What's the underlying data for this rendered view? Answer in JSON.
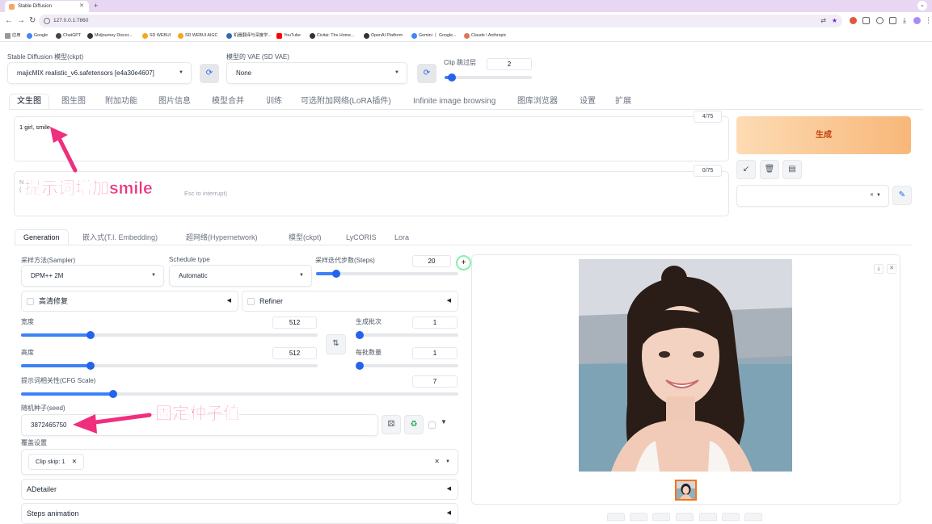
{
  "browser": {
    "tab_title": "Stable Diffusion",
    "url": "127.0.0.1:7860",
    "bookmarks": [
      "应用",
      "Google",
      "ChatGPT",
      "Midjourney Discor...",
      "SD WEBUI",
      "SD WEBUI AIGC",
      "机器翻译与深度学...",
      "YouTube",
      "Civitai: The Home...",
      "OpenAI Platform",
      "Gemini 丨 Google...",
      "Claude \\ Anthropic"
    ]
  },
  "top": {
    "model_label": "Stable Diffusion 模型(ckpt)",
    "model_value": "majicMIX realistic_v6.safetensors [e4a30e4607]",
    "vae_label": "模型的 VAE (SD VAE)",
    "vae_value": "None",
    "clip_label": "Clip 跳过层",
    "clip_value": "2",
    "clip_fraction": 0.083
  },
  "main_tabs": [
    "文生图",
    "图生图",
    "附加功能",
    "图片信息",
    "模型合并",
    "训练",
    "可选附加网络(LoRA插件)",
    "Infinite image browsing",
    "图库浏览器",
    "设置",
    "扩展"
  ],
  "prompt": {
    "text": "1 girl, smile",
    "counter": "4/75",
    "neg_placeholder_1": "N",
    "neg_placeholder_2": "(",
    "neg_placeholder_3": "Esc to interrupt)",
    "neg_counter": "0/75"
  },
  "generate_label": "生成",
  "sub_tabs": [
    "Generation",
    "嵌入式(T.I. Embedding)",
    "超网络(Hypernetwork)",
    "模型(ckpt)",
    "LyCORIS",
    "Lora"
  ],
  "gen": {
    "sampler_label": "采样方法(Sampler)",
    "sampler_value": "DPM++ 2M",
    "schedule_label": "Schedule type",
    "schedule_value": "Automatic",
    "steps_label": "采样迭代步数(Steps)",
    "steps_value": "20",
    "steps_fraction": 0.14,
    "hires_label": "高清修复",
    "refiner_label": "Refiner",
    "width_label": "宽度",
    "width_value": "512",
    "height_label": "高度",
    "height_value": "512",
    "batch_count_label": "生成批次",
    "batch_count_value": "1",
    "batch_size_label": "每批数量",
    "batch_size_value": "1",
    "cfg_label": "提示词相关性(CFG Scale)",
    "cfg_value": "7",
    "cfg_fraction": 0.21,
    "seed_label": "随机种子(seed)",
    "seed_value": "3872465750",
    "override_label": "覆盖设置",
    "override_chip": "Clip skip: 1",
    "adetailer_label": "ADetailer",
    "steps_animation_label": "Steps animation"
  },
  "annotations": {
    "prompt_note": "提示词增加smile",
    "seed_note": "固定种子值"
  },
  "colors": {
    "accent": "#3b82f6",
    "generate_text": "#c2410c",
    "annotation": "#ef2f7e"
  }
}
